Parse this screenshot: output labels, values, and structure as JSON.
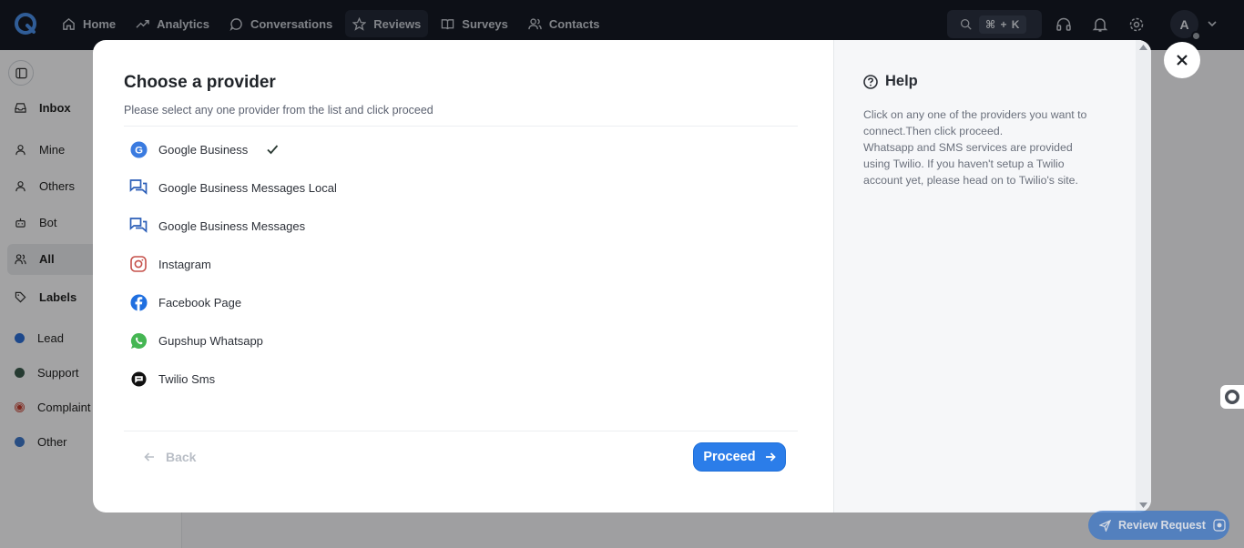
{
  "nav": {
    "items": [
      {
        "label": "Home",
        "icon": "home-icon"
      },
      {
        "label": "Analytics",
        "icon": "trend-icon"
      },
      {
        "label": "Conversations",
        "icon": "chat-icon"
      },
      {
        "label": "Reviews",
        "icon": "star-icon"
      },
      {
        "label": "Surveys",
        "icon": "book-icon"
      },
      {
        "label": "Contacts",
        "icon": "users-icon"
      }
    ],
    "active": "Reviews",
    "search_shortcut": "⌘ + K",
    "avatar_initial": "A"
  },
  "sidebar": {
    "inbox_label": "Inbox",
    "items": [
      {
        "label": "Mine"
      },
      {
        "label": "Others"
      },
      {
        "label": "Bot"
      },
      {
        "label": "All"
      }
    ],
    "labels_heading": "Labels",
    "labels": [
      {
        "label": "Lead",
        "color": "#2d6fd6"
      },
      {
        "label": "Support",
        "color": "#3b5b4e"
      },
      {
        "label": "Complaint",
        "color": "#c0392b"
      },
      {
        "label": "Other",
        "color": "#3f79c9"
      }
    ]
  },
  "modal": {
    "title": "Choose a provider",
    "subtitle": "Please select any one provider from the list and click proceed",
    "providers": [
      {
        "label": "Google Business",
        "icon": "google-icon",
        "selected": true
      },
      {
        "label": "Google Business Messages Local",
        "icon": "messages-icon",
        "selected": false
      },
      {
        "label": "Google Business Messages",
        "icon": "messages-icon",
        "selected": false
      },
      {
        "label": "Instagram",
        "icon": "instagram-icon",
        "selected": false
      },
      {
        "label": "Facebook Page",
        "icon": "facebook-icon",
        "selected": false
      },
      {
        "label": "Gupshup Whatsapp",
        "icon": "whatsapp-icon",
        "selected": false
      },
      {
        "label": "Twilio Sms",
        "icon": "twilio-icon",
        "selected": false
      }
    ],
    "back_label": "Back",
    "proceed_label": "Proceed",
    "help": {
      "title": "Help",
      "lines": [
        "Click on any one of the providers you want to",
        "connect.Then click proceed.",
        "Whatsapp and SMS services are provided",
        "using Twilio. If you haven't setup a Twilio",
        "account yet, please head on to Twilio's site."
      ]
    }
  },
  "review_request_label": "Review Request",
  "colors": {
    "accent": "#2b7de9",
    "nav_bg": "#151a24"
  }
}
